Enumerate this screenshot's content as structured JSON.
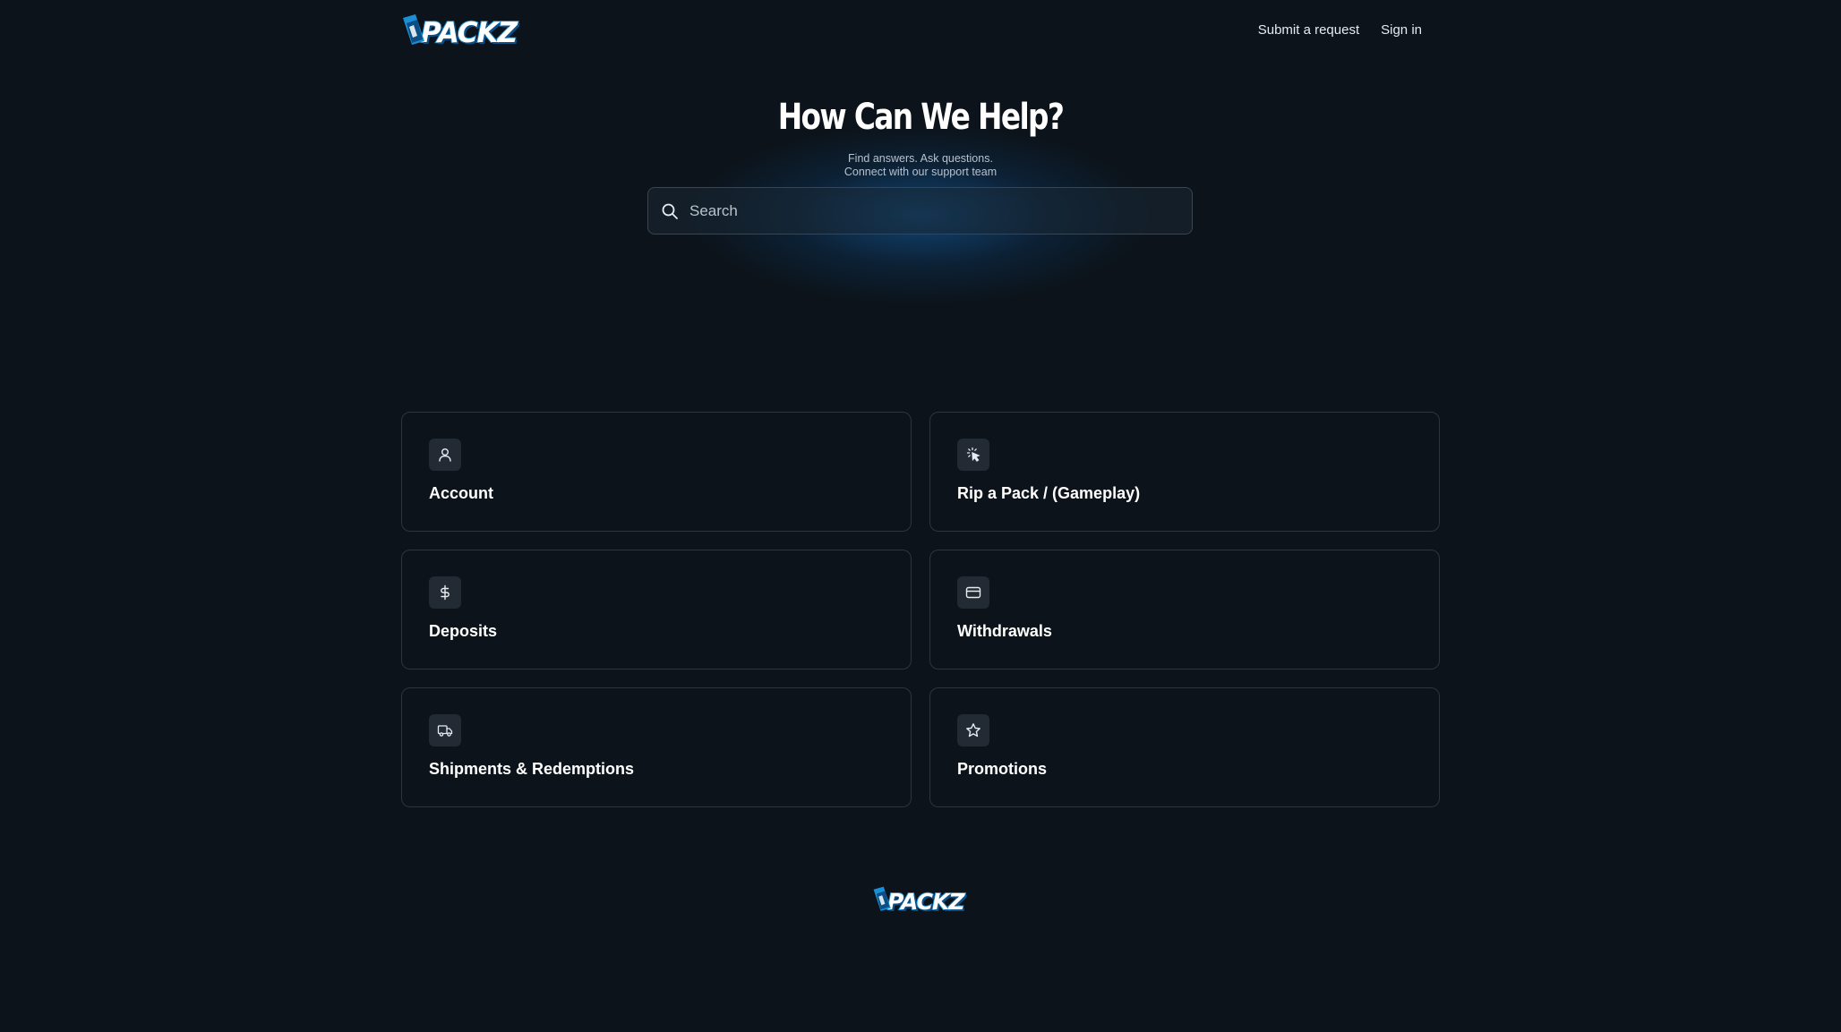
{
  "header": {
    "logo_text": "PACKZ",
    "nav": {
      "submit_request": "Submit a request",
      "sign_in": "Sign in"
    }
  },
  "hero": {
    "title": "How Can We Help?",
    "subtitle_line1": "Find answers. Ask questions.",
    "subtitle_line2": "Connect with our support team",
    "search_placeholder": "Search"
  },
  "categories": [
    {
      "label": "Account",
      "icon": "user-icon"
    },
    {
      "label": "Rip a Pack / (Gameplay)",
      "icon": "click-sparkle-icon"
    },
    {
      "label": "Deposits",
      "icon": "dollar-icon"
    },
    {
      "label": "Withdrawals",
      "icon": "credit-card-icon"
    },
    {
      "label": "Shipments & Redemptions",
      "icon": "truck-icon"
    },
    {
      "label": "Promotions",
      "icon": "star-icon"
    }
  ],
  "footer": {
    "logo_text": "PACKZ"
  },
  "colors": {
    "background": "#0c131a",
    "accent": "#1a8fd6",
    "card_border": "#2c353e",
    "icon_tile": "#222a33"
  }
}
